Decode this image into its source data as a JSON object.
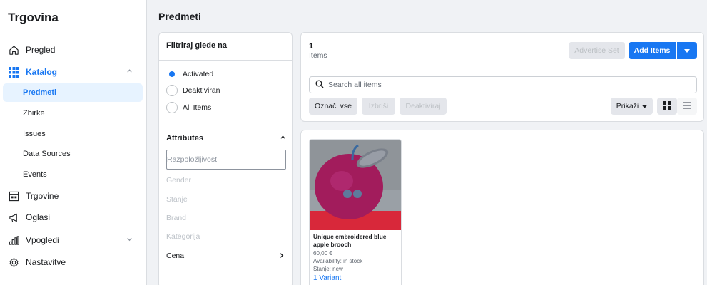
{
  "app": {
    "brand": "Trgovina"
  },
  "sidebar": {
    "items": [
      {
        "label": "Pregled",
        "icon": "home-icon"
      },
      {
        "label": "Katalog",
        "icon": "grid-icon"
      },
      {
        "label": "Trgovine",
        "icon": "shop-icon"
      },
      {
        "label": "Oglasi",
        "icon": "megaphone-icon"
      },
      {
        "label": "Vpogledi",
        "icon": "chart-icon"
      },
      {
        "label": "Nastavitve",
        "icon": "gear-icon"
      }
    ],
    "catalog_sub": [
      "Predmeti",
      "Zbirke",
      "Issues",
      "Data Sources",
      "Events"
    ]
  },
  "page": {
    "title": "Predmeti"
  },
  "filter": {
    "title": "Filtriraj glede na",
    "status_options": [
      "Activated",
      "Deaktiviran",
      "All Items"
    ],
    "selected_status": "Activated",
    "attributes_title": "Attributes",
    "attribute_search_placeholder": "Razpoložljivost",
    "attributes": [
      "Gender",
      "Stanje",
      "Brand",
      "Kategorija",
      "Cena"
    ]
  },
  "toolbar": {
    "count": "1",
    "count_label": "Items",
    "advertise_set": "Advertise Set",
    "add_items": "Add Items",
    "search_placeholder": "Search all items",
    "select_all": "Označi vse",
    "delete": "Izbriši",
    "deactivate": "Deaktiviraj",
    "show": "Prikaži"
  },
  "items": [
    {
      "title": "Unique embroidered blue apple brooch",
      "price": "60,00 €",
      "availability": "Availability: in stock",
      "condition": "Stanje: new",
      "variants": "1 Variant"
    }
  ],
  "colors": {
    "accent": "#1877f2",
    "active_bg": "#e7f3ff",
    "background": "#f0f2f5"
  }
}
